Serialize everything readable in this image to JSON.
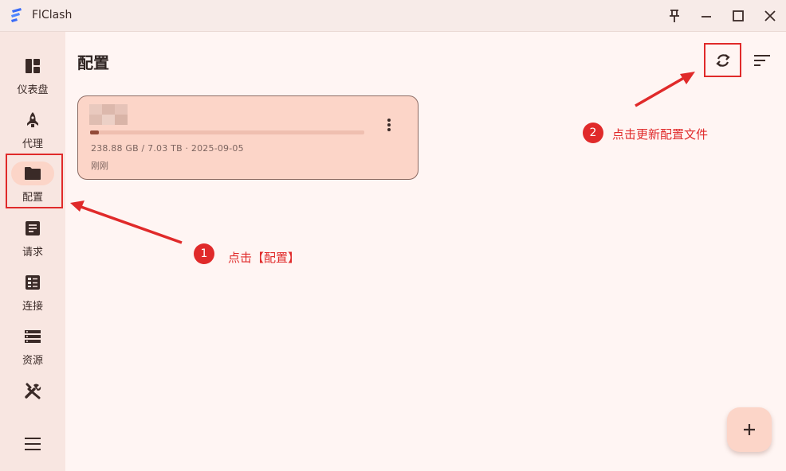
{
  "window": {
    "title": "FlClash",
    "controls": [
      "pin-icon",
      "minimize-icon",
      "maximize-icon",
      "close-icon"
    ]
  },
  "sidebar": {
    "items": [
      {
        "label": "仪表盘",
        "icon": "dashboard-icon"
      },
      {
        "label": "代理",
        "icon": "rocket-icon"
      },
      {
        "label": "配置",
        "icon": "folder-icon",
        "active": true
      },
      {
        "label": "请求",
        "icon": "request-log-icon"
      },
      {
        "label": "连接",
        "icon": "connections-icon"
      },
      {
        "label": "资源",
        "icon": "storage-icon"
      },
      {
        "label": "工具",
        "icon": "tools-icon"
      }
    ],
    "menu_icon": "hamburger-menu-icon"
  },
  "main": {
    "title": "配置",
    "header_actions": [
      "sync-icon",
      "sort-icon"
    ],
    "profiles": [
      {
        "name": "",
        "usage_fraction": 0.033,
        "meta": "238.88 GB / 7.03 TB · 2025-09-05",
        "updated": "刚刚"
      }
    ],
    "fab_icon": "plus-icon"
  },
  "annotations": {
    "step1_number": "1",
    "step1_text": "点击【配置】",
    "step2_number": "2",
    "step2_text": "点击更新配置文件"
  },
  "colors": {
    "accent": "#fcd5c8",
    "active_fill": "#934b39",
    "annotation": "#e02a2a",
    "background": "#fff5f3"
  }
}
